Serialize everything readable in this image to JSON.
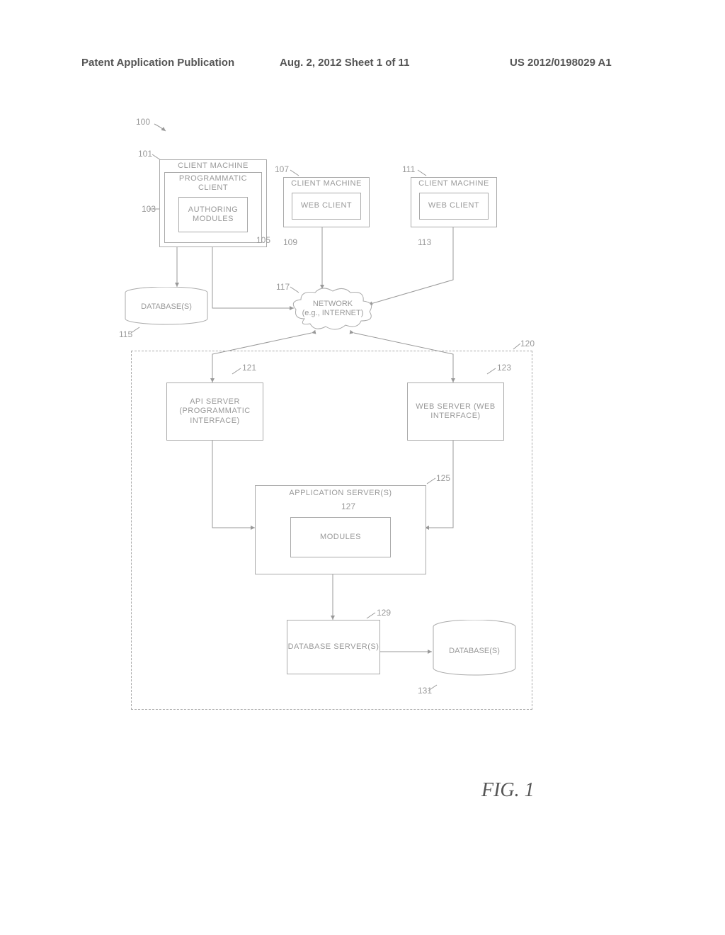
{
  "header": {
    "left": "Patent Application Publication",
    "center": "Aug. 2, 2012  Sheet 1 of 11",
    "right": "US 2012/0198029 A1"
  },
  "refs": {
    "r100": "100",
    "r101": "101",
    "r103": "103",
    "r105": "105",
    "r107": "107",
    "r109": "109",
    "r111": "111",
    "r113": "113",
    "r115": "115",
    "r117": "117",
    "r120": "120",
    "r121": "121",
    "r123": "123",
    "r125": "125",
    "r127": "127",
    "r129": "129",
    "r131": "131"
  },
  "boxes": {
    "client1_outer": "CLIENT MACHINE",
    "client1_prog": "PROGRAMMATIC CLIENT",
    "client1_auth": "AUTHORING MODULES",
    "client2_outer": "CLIENT MACHINE",
    "client2_web": "WEB CLIENT",
    "client3_outer": "CLIENT MACHINE",
    "client3_web": "WEB CLIENT",
    "network_l1": "NETWORK",
    "network_l2": "(e.g., INTERNET)",
    "db_left": "DATABASE(S)",
    "api": "API SERVER (PROGRAMMATIC INTERFACE)",
    "web": "WEB SERVER (WEB INTERFACE)",
    "appserver": "APPLICATION SERVER(S)",
    "modules": "MODULES",
    "dbserver": "DATABASE SERVER(S)",
    "db_right": "DATABASE(S)"
  },
  "figure": "FIG. 1"
}
